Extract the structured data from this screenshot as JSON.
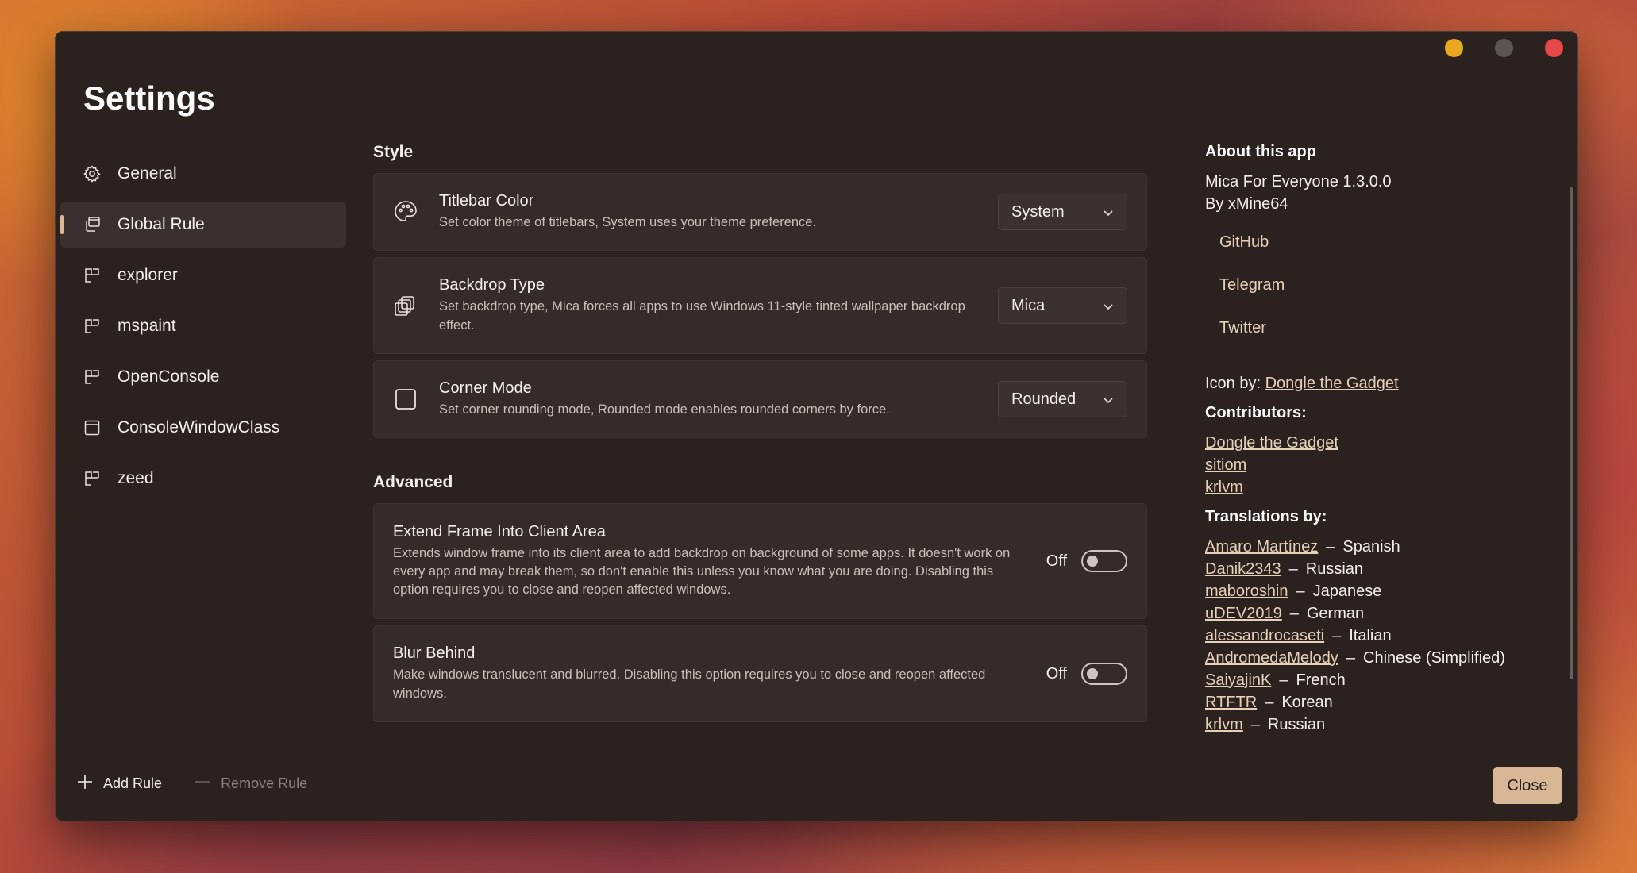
{
  "window": {
    "title": "Settings",
    "controls": [
      "minimize",
      "maximize",
      "close"
    ]
  },
  "sidebar": {
    "items": [
      {
        "label": "General",
        "icon": "gear-icon",
        "active": false
      },
      {
        "label": "Global Rule",
        "icon": "window-stack-icon",
        "active": true
      },
      {
        "label": "explorer",
        "icon": "app-rule-icon",
        "active": false
      },
      {
        "label": "mspaint",
        "icon": "app-rule-icon",
        "active": false
      },
      {
        "label": "OpenConsole",
        "icon": "app-rule-icon",
        "active": false
      },
      {
        "label": "ConsoleWindowClass",
        "icon": "class-rule-icon",
        "active": false
      },
      {
        "label": "zeed",
        "icon": "app-rule-icon",
        "active": false
      }
    ],
    "add_rule": "Add Rule",
    "remove_rule": "Remove Rule"
  },
  "style": {
    "title": "Style",
    "titlebar": {
      "title": "Titlebar Color",
      "desc": "Set color theme of titlebars, System uses your theme preference.",
      "value": "System"
    },
    "backdrop": {
      "title": "Backdrop Type",
      "desc": "Set backdrop type, Mica forces all apps to use Windows 11-style tinted wallpaper backdrop effect.",
      "value": "Mica"
    },
    "corner": {
      "title": "Corner Mode",
      "desc": "Set corner rounding mode, Rounded mode enables rounded corners by force.",
      "value": "Rounded"
    }
  },
  "advanced": {
    "title": "Advanced",
    "extend": {
      "title": "Extend Frame Into Client Area",
      "desc": "Extends window frame into its client area to add backdrop on background of some apps. It doesn't work on every app and may break them, so don't enable this unless you know what you are doing. Disabling this option requires you to close and reopen affected windows.",
      "state": "Off"
    },
    "blur": {
      "title": "Blur Behind",
      "desc": "Make windows translucent and blurred. Disabling this option requires you to close and reopen affected windows.",
      "state": "Off"
    }
  },
  "about": {
    "title": "About this app",
    "app_name": "Mica For Everyone 1.3.0.0",
    "author": "By xMine64",
    "links": [
      "GitHub",
      "Telegram",
      "Twitter"
    ],
    "icon_by_label": "Icon by:",
    "icon_by_name": "Dongle the Gadget",
    "contributors_title": "Contributors:",
    "contributors": [
      "Dongle the Gadget",
      "sitiom",
      "krlvm"
    ],
    "translations_title": "Translations by:",
    "translations": [
      {
        "name": "Amaro Martínez",
        "lang": "Spanish"
      },
      {
        "name": "Danik2343",
        "lang": "Russian"
      },
      {
        "name": "maboroshin",
        "lang": "Japanese"
      },
      {
        "name": "uDEV2019",
        "lang": "German"
      },
      {
        "name": "alessandrocaseti",
        "lang": "Italian"
      },
      {
        "name": "AndromedaMelody",
        "lang": "Chinese (Simplified)"
      },
      {
        "name": "SaiyajinK",
        "lang": "French"
      },
      {
        "name": "RTFTR",
        "lang": "Korean"
      },
      {
        "name": "krlvm",
        "lang": "Russian"
      }
    ]
  },
  "close_label": "Close",
  "colors": {
    "accent": "#d7b795",
    "window_bg": "#2b2220",
    "card_bg": "#352b28",
    "link": "#e6d1b8"
  }
}
